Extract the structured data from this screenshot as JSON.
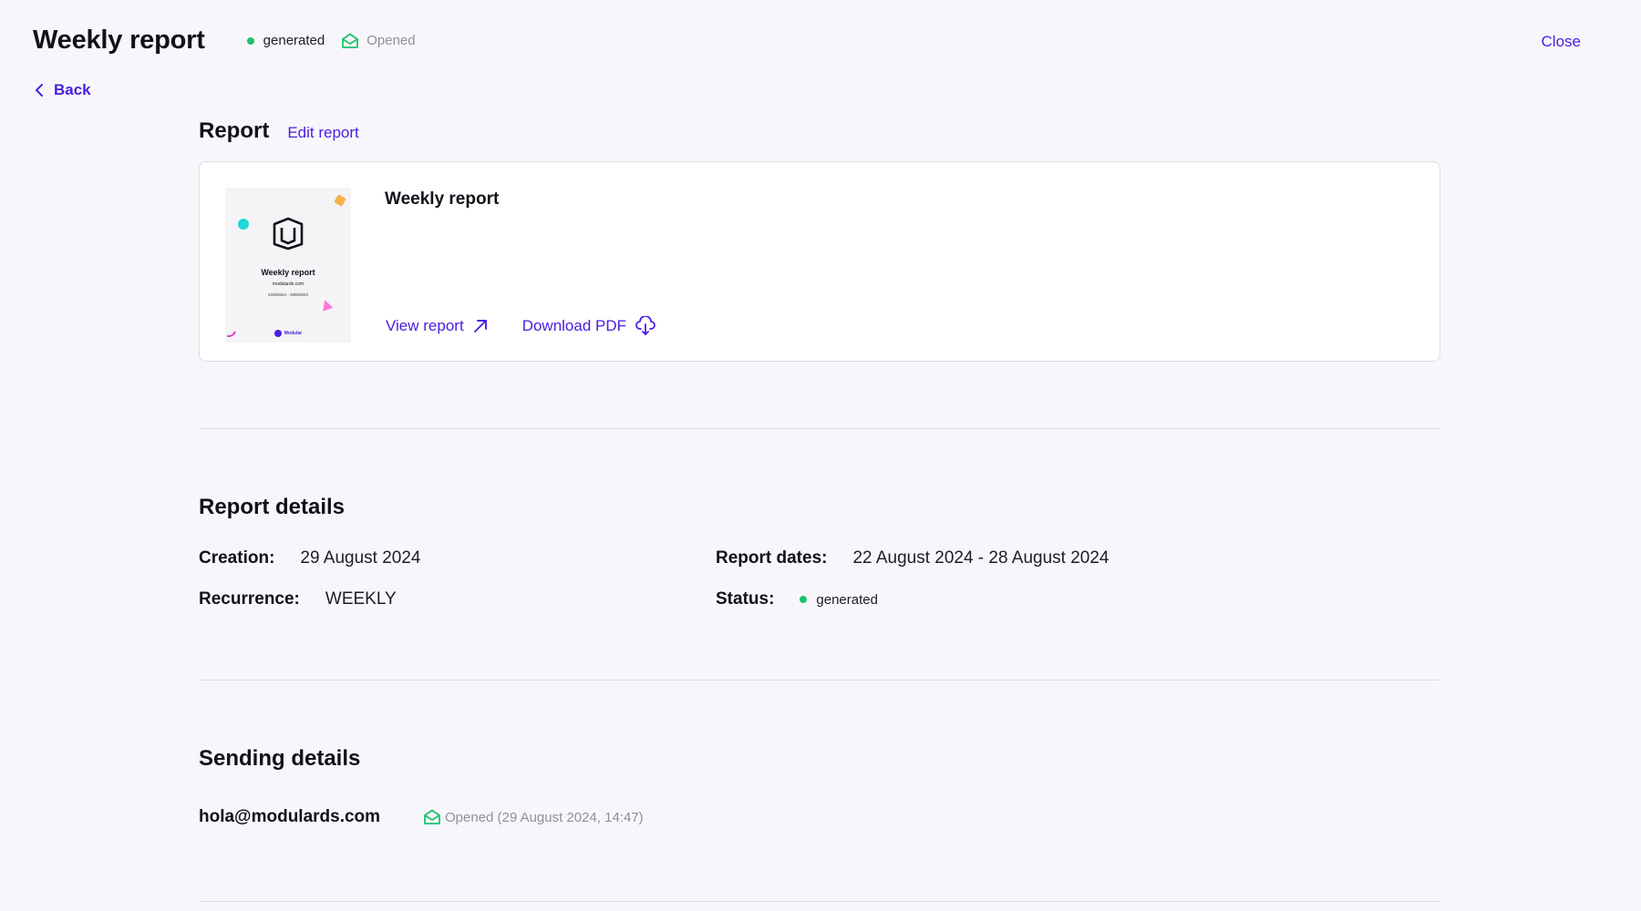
{
  "header": {
    "title": "Weekly report",
    "status": "generated",
    "opened": "Opened",
    "close": "Close",
    "back": "Back"
  },
  "report_section": {
    "title": "Report",
    "edit": "Edit report",
    "card": {
      "title": "Weekly report",
      "view": "View report",
      "download": "Download PDF",
      "thumbnail": {
        "title": "Weekly report",
        "site": "modulards.com",
        "dates": "22/8/2024 - 28/8/2024",
        "brand": "Modular"
      }
    }
  },
  "details": {
    "title": "Report details",
    "creation_label": "Creation:",
    "creation_value": "29 August 2024",
    "recurrence_label": "Recurrence:",
    "recurrence_value": "WEEKLY",
    "dates_label": "Report dates:",
    "dates_value": "22 August 2024 - 28 August 2024",
    "status_label": "Status:",
    "status_value": "generated"
  },
  "sending": {
    "title": "Sending details",
    "email": "hola@modulards.com",
    "email_status": "Opened (29 August 2024, 14:47)"
  },
  "colors": {
    "accent": "#4a1fe0",
    "success": "#1fc16b",
    "muted": "#8e8e9e",
    "background": "#f7f7fb"
  },
  "icons": [
    "envelope-open-icon",
    "chevron-left-icon",
    "arrow-up-right-icon",
    "cloud-download-icon",
    "logo-icon"
  ]
}
